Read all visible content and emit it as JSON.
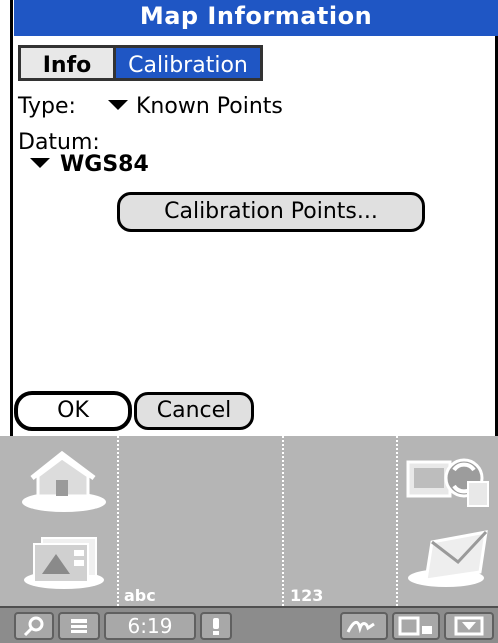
{
  "window": {
    "title": "Map Information"
  },
  "tabs": [
    {
      "label": "Info",
      "selected": false
    },
    {
      "label": "Calibration",
      "selected": true
    }
  ],
  "form": {
    "type_label": "Type:",
    "type_value": "Known Points",
    "datum_label": "Datum:",
    "datum_value": "WGS84",
    "calibration_points_button": "Calibration Points..."
  },
  "buttons": {
    "ok": "OK",
    "cancel": "Cancel"
  },
  "silkscreen": {
    "left_label": "abc",
    "right_label": "123",
    "icons": [
      "home-icon",
      "applications-icon",
      "hotsync-icon",
      "mail-icon"
    ]
  },
  "status_bar": {
    "clock": "6:19",
    "icons": [
      "find-icon",
      "menu-icon",
      "alert-icon",
      "graffiti-icon",
      "screen-icon",
      "hide-icon"
    ]
  },
  "colors": {
    "accent": "#1f56c4",
    "silk_bg": "#b5b5b5",
    "status_bg": "#8c8c8c"
  }
}
